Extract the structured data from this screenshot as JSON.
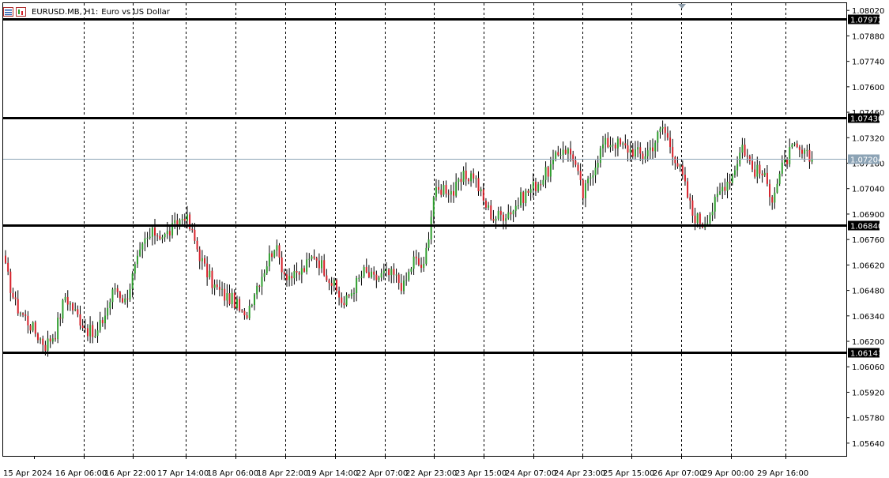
{
  "window": {
    "symbol": "EURUSD.MB",
    "timeframe": "H1:",
    "description": "Euro vs US Dollar",
    "icons": [
      "chart-properties-icon",
      "chart-window-icon"
    ]
  },
  "colors": {
    "bull": "#2f9e2f",
    "bear": "#d6202a",
    "wick": "#000000",
    "grid": "#000000",
    "hline": "#000000",
    "bid_line": "#8ca3b5",
    "bid_label_bg": "#8ca3b5",
    "axis_label_bg": "#000000",
    "axis_label_text": "#ffffff"
  },
  "chart_data": {
    "type": "candlestick",
    "symbol": "EURUSD.MB",
    "timeframe": "H1",
    "ylim": [
      1.0557,
      1.0806
    ],
    "grid": "dashed vertical",
    "price_ticks": [
      "1.08020",
      "1.07880",
      "1.07740",
      "1.07600",
      "1.07460",
      "1.07320",
      "1.07180",
      "1.07040",
      "1.06900",
      "1.06760",
      "1.06620",
      "1.06480",
      "1.06340",
      "1.06200",
      "1.06060",
      "1.05920",
      "1.05780",
      "1.05640"
    ],
    "time_labels": [
      "15 Apr 2024",
      "16 Apr 06:00",
      "16 Apr 22:00",
      "17 Apr 14:00",
      "18 Apr 06:00",
      "18 Apr 22:00",
      "19 Apr 14:00",
      "22 Apr 07:00",
      "22 Apr 23:00",
      "23 Apr 15:00",
      "24 Apr 07:00",
      "24 Apr 23:00",
      "25 Apr 15:00",
      "26 Apr 07:00",
      "29 Apr 00:00",
      "29 Apr 16:00"
    ],
    "horizontal_lines": [
      1.07972,
      1.0743,
      1.0684,
      1.06141
    ],
    "horizontal_line_labels": [
      "1.07972",
      "1.07430",
      "1.06840",
      "1.06141"
    ],
    "bid_price": 1.07204,
    "bid_label": "1.07204",
    "close_anchors": [
      [
        0,
        1.066
      ],
      [
        4,
        1.064
      ],
      [
        8,
        1.0633
      ],
      [
        12,
        1.0625
      ],
      [
        16,
        1.0618
      ],
      [
        20,
        1.0625
      ],
      [
        24,
        1.0645
      ],
      [
        28,
        1.0636
      ],
      [
        32,
        1.0628
      ],
      [
        36,
        1.0622
      ],
      [
        40,
        1.0635
      ],
      [
        44,
        1.065
      ],
      [
        48,
        1.0642
      ],
      [
        52,
        1.066
      ],
      [
        56,
        1.0675
      ],
      [
        60,
        1.068
      ],
      [
        64,
        1.0678
      ],
      [
        68,
        1.0683
      ],
      [
        72,
        1.069
      ],
      [
        76,
        1.0675
      ],
      [
        80,
        1.066
      ],
      [
        84,
        1.065
      ],
      [
        88,
        1.0645
      ],
      [
        92,
        1.0642
      ],
      [
        96,
        1.0632
      ],
      [
        100,
        1.0648
      ],
      [
        104,
        1.066
      ],
      [
        108,
        1.0673
      ],
      [
        112,
        1.0658
      ],
      [
        116,
        1.0655
      ],
      [
        120,
        1.066
      ],
      [
        124,
        1.0668
      ],
      [
        128,
        1.066
      ],
      [
        132,
        1.065
      ],
      [
        136,
        1.064
      ],
      [
        140,
        1.065
      ],
      [
        144,
        1.0658
      ],
      [
        148,
        1.0654
      ],
      [
        152,
        1.0657
      ],
      [
        156,
        1.0656
      ],
      [
        160,
        1.065
      ],
      [
        164,
        1.0665
      ],
      [
        168,
        1.066
      ],
      [
        172,
        1.07
      ],
      [
        176,
        1.0705
      ],
      [
        180,
        1.0702
      ],
      [
        184,
        1.071
      ],
      [
        188,
        1.0712
      ],
      [
        192,
        1.0697
      ],
      [
        196,
        1.0688
      ],
      [
        200,
        1.069
      ],
      [
        204,
        1.0693
      ],
      [
        208,
        1.07
      ],
      [
        212,
        1.0705
      ],
      [
        216,
        1.071
      ],
      [
        220,
        1.0718
      ],
      [
        224,
        1.0727
      ],
      [
        228,
        1.0722
      ],
      [
        232,
        1.07
      ],
      [
        236,
        1.0715
      ],
      [
        240,
        1.0728
      ],
      [
        244,
        1.073
      ],
      [
        248,
        1.0727
      ],
      [
        252,
        1.0725
      ],
      [
        256,
        1.0722
      ],
      [
        260,
        1.0728
      ],
      [
        264,
        1.0738
      ],
      [
        268,
        1.0725
      ],
      [
        272,
        1.071
      ],
      [
        276,
        1.069
      ],
      [
        280,
        1.0685
      ],
      [
        284,
        1.0693
      ],
      [
        288,
        1.0705
      ],
      [
        292,
        1.0712
      ],
      [
        296,
        1.0728
      ],
      [
        300,
        1.0715
      ],
      [
        304,
        1.0712
      ],
      [
        308,
        1.07
      ],
      [
        312,
        1.0715
      ],
      [
        316,
        1.0726
      ],
      [
        320,
        1.0723
      ],
      [
        324,
        1.072
      ]
    ]
  }
}
